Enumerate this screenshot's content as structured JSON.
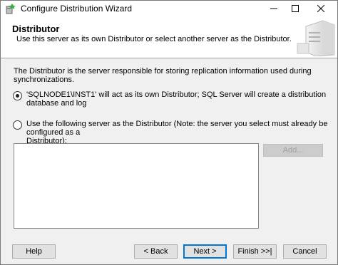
{
  "window": {
    "title": "Configure Distribution Wizard"
  },
  "header": {
    "title": "Distributor",
    "subtitle": "Use this server as its own Distributor or select another server as the Distributor."
  },
  "body": {
    "description": "The Distributor is the server responsible for storing replication information used during synchronizations.",
    "options": [
      {
        "label": "'SQLNODE1\\INST1' will act as its own Distributor; SQL Server will create a distribution database and log",
        "selected": true
      },
      {
        "label_line1": "Use the following server as the Distributor (Note: the server you select must already be configured as a",
        "label_line2": "Distributor):",
        "selected": false
      }
    ],
    "add_button": "Add..."
  },
  "footer": {
    "help": "Help",
    "back": "< Back",
    "next": "Next >",
    "finish": "Finish >>|",
    "cancel": "Cancel"
  },
  "icons": [
    "wizard-app-icon",
    "minimize-icon",
    "maximize-icon",
    "close-icon",
    "server-illustration-icon"
  ]
}
